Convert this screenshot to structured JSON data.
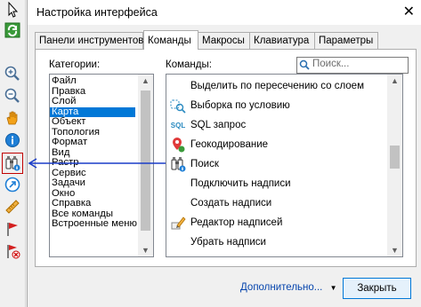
{
  "dialog": {
    "title": "Настройка интерфейса",
    "close_glyph": "✕"
  },
  "tabs": [
    {
      "label": "Панели инструментов"
    },
    {
      "label": "Команды"
    },
    {
      "label": "Макросы"
    },
    {
      "label": "Клавиатура"
    },
    {
      "label": "Параметры"
    }
  ],
  "categories": {
    "label": "Категории:",
    "items": [
      "Файл",
      "Правка",
      "Слой",
      "Карта",
      "Объект",
      "Топология",
      "Формат",
      "Вид",
      "Растр",
      "Сервис",
      "Задачи",
      "Окно",
      "Справка",
      "Все команды",
      "Встроенные меню"
    ],
    "selected": "Карта"
  },
  "commands": {
    "label": "Команды:",
    "search_placeholder": "Поиск...",
    "items": [
      {
        "label": "Выделить по пересечению со слоем",
        "icon": "select-by-intersect-icon"
      },
      {
        "label": "Выборка по условию",
        "icon": "select-by-attributes-icon"
      },
      {
        "label": "SQL запрос",
        "icon": "sql-icon"
      },
      {
        "label": "Геокодирование",
        "icon": "geocode-icon"
      },
      {
        "label": "Поиск",
        "icon": "binoculars-icon"
      },
      {
        "label": "Подключить надписи",
        "icon": "none"
      },
      {
        "label": "Создать надписи",
        "icon": "none"
      },
      {
        "label": "Редактор надписей",
        "icon": "label-editor-icon"
      },
      {
        "label": "Убрать надписи",
        "icon": "none"
      }
    ],
    "sql_icon_text": "SQL"
  },
  "footer": {
    "more_label": "Дополнительно...",
    "close_label": "Закрыть"
  },
  "toolbar": {
    "icons": [
      "arrow-select-icon",
      "refresh-icon",
      "zoom-in-icon",
      "zoom-out-icon",
      "pan-hand-icon",
      "info-icon",
      "binoculars-icon",
      "go-to-xy-icon",
      "measure-icon",
      "flag-icon",
      "clear-flag-icon"
    ]
  },
  "colors": {
    "selection": "#0078d7",
    "link": "#0645ad",
    "drag_arrow": "#1a3cc8",
    "toolbar_highlight": "#c00000"
  }
}
